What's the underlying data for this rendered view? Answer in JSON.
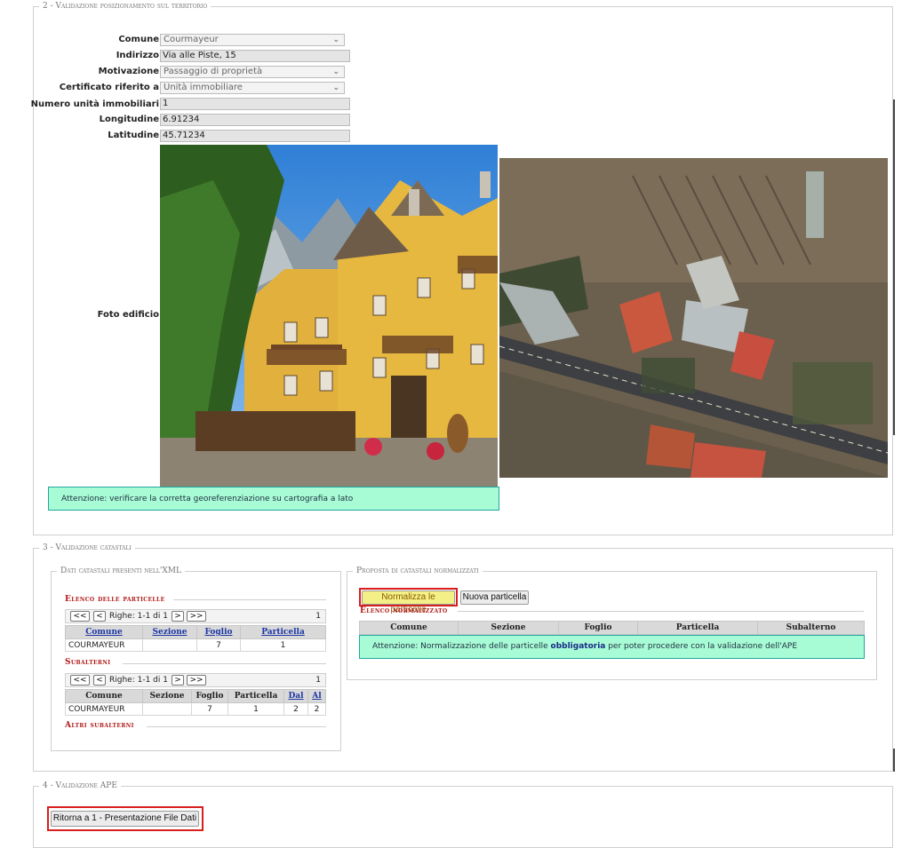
{
  "section2": {
    "legend": "2 - Validazione posizionamento sul territorio",
    "fields": {
      "comune": {
        "label": "Comune",
        "value": "Courmayeur"
      },
      "indirizzo": {
        "label": "Indirizzo",
        "value": "Via alle Piste, 15"
      },
      "motivazione": {
        "label": "Motivazione",
        "value": "Passaggio di proprietà"
      },
      "certificato": {
        "label": "Certificato riferito a",
        "value": "Unità immobiliare"
      },
      "numero": {
        "label": "Numero unità immobiliari",
        "value": "1"
      },
      "longitudine": {
        "label": "Longitudine",
        "value": "6.91234"
      },
      "latitudine": {
        "label": "Latitudine",
        "value": "45.71234"
      },
      "foto": {
        "label": "Foto edificio"
      }
    },
    "notice": "Attenzione: verificare la corretta georeferenziazione su cartografia a lato"
  },
  "section3": {
    "legend": "3 - Validazione catastali",
    "xml": {
      "legend": "Dati catastali presenti nell'XML",
      "particelle": {
        "title": "Elenco delle particelle",
        "pager": {
          "first": "<<",
          "prev": "<",
          "info": "Righe: 1-1 di 1",
          "next": ">",
          "last": ">>",
          "count": "1"
        },
        "headers": [
          "Comune",
          "Sezione",
          "Foglio",
          "Particella"
        ],
        "rows": [
          [
            "COURMAYEUR",
            "",
            "7",
            "1"
          ]
        ]
      },
      "subalterni": {
        "title": "Subalterni",
        "pager": {
          "first": "<<",
          "prev": "<",
          "info": "Righe: 1-1 di 1",
          "next": ">",
          "last": ">>",
          "count": "1"
        },
        "headers": [
          "Comune",
          "Sezione",
          "Foglio",
          "Particella",
          "Dal",
          "Al"
        ],
        "rows": [
          [
            "COURMAYEUR",
            "",
            "7",
            "1",
            "2",
            "2"
          ]
        ]
      },
      "altri": {
        "title": "Altri subalterni"
      }
    },
    "proposta": {
      "legend": "Proposta di catastali normalizzati",
      "normalizza_label": "Normalizza le particelle",
      "nuova_label": "Nuova particella",
      "elenco_title": "Elenco normalizzato",
      "headers": [
        "Comune",
        "Sezione",
        "Foglio",
        "Particella",
        "Subalterno"
      ],
      "notice_pre": "Attenzione: Normalizzazione delle particelle ",
      "notice_bold": "obbligatoria",
      "notice_post": " per poter procedere con la validazione dell'APE"
    }
  },
  "section4": {
    "legend": "4 - Validazione APE",
    "ritorna_label": "Ritorna a 1 - Presentazione File Dati"
  },
  "icons": {
    "dropdown": "chevron-down-icon"
  },
  "colors": {
    "notice_bg": "#a7fbd5",
    "notice_border": "#22a7a2",
    "highlight_frame": "#d91e1e",
    "subsection_title": "#b01818",
    "link": "#1d36a3",
    "highlight_btn": "#f4f088"
  }
}
